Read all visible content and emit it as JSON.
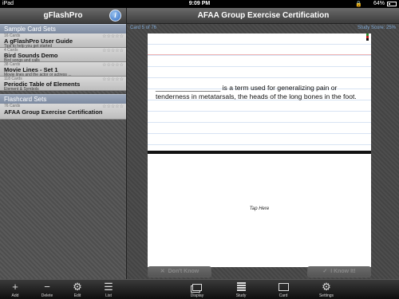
{
  "status_bar": {
    "carrier": "iPad",
    "wifi_icon": "wifi-icon",
    "time": "9:09 PM",
    "lock_icon": "lock-icon",
    "battery": "64%"
  },
  "sidebar": {
    "title": "gFlashPro",
    "info_icon": "info-icon",
    "sample_header": "Sample Card Sets",
    "sample_sets": [
      {
        "count": "16 Cards",
        "name": "A gFlashPro User Guide",
        "sub": "Tips to help you get started",
        "stars": "☆☆☆☆☆"
      },
      {
        "count": "4 Cards",
        "name": "Bird Sounds Demo",
        "sub": "Bird songs and calls",
        "stars": "☆☆☆☆☆"
      },
      {
        "count": "38 Cards",
        "name": "Movie Lines - Set 1",
        "sub": "Movie lines and the actor or actress ...",
        "stars": "☆☆☆☆☆"
      },
      {
        "count": "118 Cards",
        "name": "Periodic Table of Elements",
        "sub": "Element & Symbols",
        "stars": "☆☆☆☆☆"
      }
    ],
    "flashcard_header": "Flashcard Sets",
    "flashcard_sets": [
      {
        "count": "76 Cards",
        "name": "AFAA Group Exercise Certification",
        "stars": "☆☆☆☆☆"
      }
    ]
  },
  "main": {
    "title": "AFAA Group Exercise Certification",
    "card_position": "Card 5 of 76",
    "study_score": "Study Score: 25%",
    "question": "_________________ is a term used for generalizing pain or tenderness in metatarsals, the heads of the long bones in the foot.",
    "tap_hint": "Tap Here",
    "dont_know": "Don't Know",
    "know_it": "I Know It!",
    "accent_color": "#7fa9d6"
  },
  "toolbar": {
    "add": "Add",
    "delete": "Delete",
    "edit": "Edit",
    "list": "List",
    "display": "Display",
    "study": "Study",
    "card": "Card",
    "settings": "Settings"
  }
}
